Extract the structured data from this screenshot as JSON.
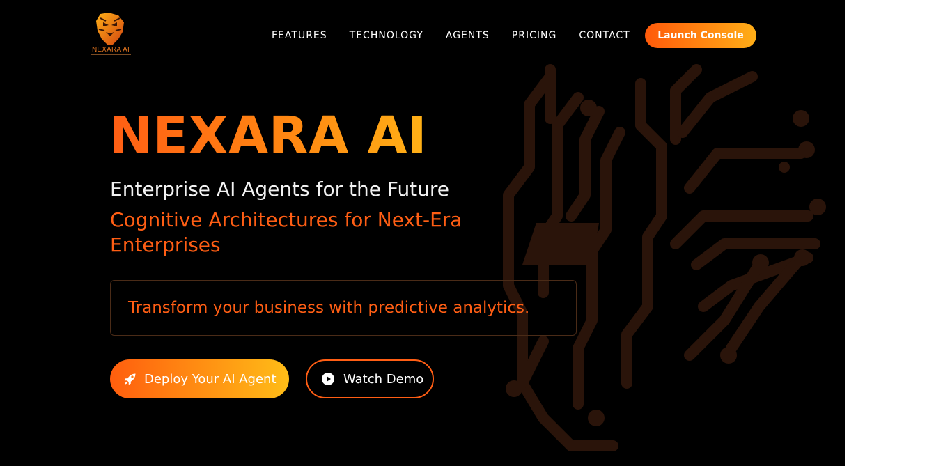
{
  "brand": {
    "logo_icon": "lion-head-icon",
    "logo_text": "NEXARA AI"
  },
  "nav": {
    "items": [
      {
        "label": "FEATURES"
      },
      {
        "label": "TECHNOLOGY"
      },
      {
        "label": "AGENTS"
      },
      {
        "label": "PRICING"
      },
      {
        "label": "CONTACT"
      }
    ],
    "cta_label": "Launch Console"
  },
  "hero": {
    "title": "NEXARA AI",
    "subtitle": "Enterprise AI Agents for the Future",
    "tagline": "Cognitive Architectures for Next-Era Enterprises",
    "typed_text": "Transform your business with predictive analytics.",
    "primary_button": {
      "label": "Deploy Your AI Agent",
      "icon": "rocket-icon"
    },
    "secondary_button": {
      "label": "Watch Demo",
      "icon": "play-circle-icon"
    },
    "background_art": "circuit-head-icon"
  },
  "colors": {
    "background": "#000000",
    "accent_orange": "#ff5e14",
    "accent_amber": "#ffb116",
    "text": "#ffffff"
  }
}
